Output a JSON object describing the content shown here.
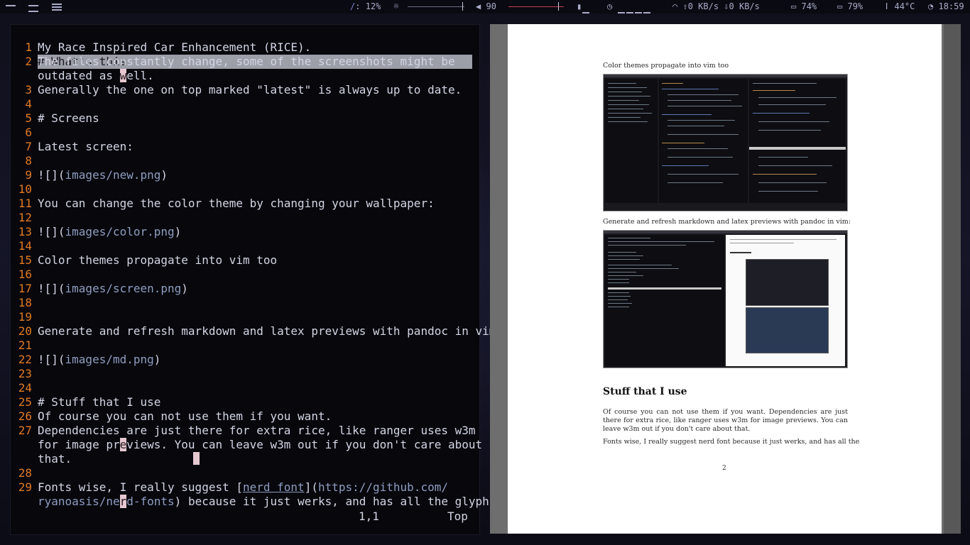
{
  "topbar": {
    "brightness_label": "12%",
    "volume_label": "90",
    "network_up": "0 KB/s",
    "network_down": "0 KB/s",
    "battery1": "74%",
    "battery2": "79%",
    "temperature": "44°C",
    "clock": "18:59",
    "brightness_level": 0.12,
    "volume_level": 0.9,
    "colors": {
      "accent": "#c04050",
      "text": "#a9acc8"
    }
  },
  "editor": {
    "lines": [
      {
        "num": "1",
        "text": "# What's this"
      },
      {
        "num": "1",
        "text": "My Race Inspired Car Enhancement (RICE)."
      },
      {
        "num": "2",
        "text": "The files constantly change, some of the screenshots might be"
      },
      {
        "num": "",
        "text_a": "outdated as ",
        "cursor_char": "w",
        "text_b": "ell."
      },
      {
        "num": "3",
        "text": "Generally the one on top marked \"latest\" is always up to date."
      },
      {
        "num": "4",
        "text": ""
      },
      {
        "num": "5",
        "text": "# Screens"
      },
      {
        "num": "6",
        "text": ""
      },
      {
        "num": "7",
        "text": "Latest screen:"
      },
      {
        "num": "8",
        "text": ""
      },
      {
        "num": "9",
        "prefix": "![](",
        "link": "images/new.png",
        "suffix": ")"
      },
      {
        "num": "10",
        "text": ""
      },
      {
        "num": "11",
        "text": "You can change the color theme by changing your wallpaper:"
      },
      {
        "num": "12",
        "text": ""
      },
      {
        "num": "13",
        "prefix": "![](",
        "link": "images/color.png",
        "suffix": ")"
      },
      {
        "num": "14",
        "text": ""
      },
      {
        "num": "15",
        "text": "Color themes propagate into vim too"
      },
      {
        "num": "16",
        "text": ""
      },
      {
        "num": "17",
        "prefix": "![](",
        "link": "images/screen.png",
        "suffix": ")"
      },
      {
        "num": "18",
        "text": ""
      },
      {
        "num": "19",
        "text": ""
      },
      {
        "num": "20",
        "text": "Generate and refresh markdown and latex previews with pandoc in vim:"
      },
      {
        "num": "21",
        "text": ""
      },
      {
        "num": "22",
        "prefix": "![](",
        "link": "images/md.png",
        "suffix": ")"
      },
      {
        "num": "23",
        "text": ""
      },
      {
        "num": "24",
        "text": ""
      },
      {
        "num": "25",
        "text": "# Stuff that I use"
      },
      {
        "num": "26",
        "text": "Of course you can not use them if you want."
      },
      {
        "num": "27",
        "text": "Dependencies are just there for extra rice, like ranger uses w3m"
      },
      {
        "num": "",
        "text_a": "for image pr",
        "cursor_char": "e",
        "text_b": "views. You can leave w3m out if you don't care about"
      },
      {
        "num": "",
        "text": "that."
      },
      {
        "num": "28",
        "text": ""
      },
      {
        "num": "29",
        "text_a": "Fonts wise, I really suggest [",
        "ul": "nerd font",
        "text_b": "](",
        "link": "https://github.com/"
      },
      {
        "num": "",
        "link_a": "ryanoasis/ne",
        "cursor_char": "r",
        "link_b": "d-fonts",
        "text_b": ") because it just werks, and has all the glyphs."
      }
    ],
    "status_position": "1,1",
    "status_scroll": "Top"
  },
  "preview": {
    "caption1": "Color themes propagate into vim too",
    "caption2": "Generate and refresh markdown and latex previews with pandoc in vim:",
    "heading": "Stuff that I use",
    "para1": "Of course you can not use them if you want. Dependencies are just there for extra rice, like ranger uses w3m for image previews. You can leave w3m out if you don't care about that.",
    "para2": "Fonts wise, I really suggest nerd font because it just werks, and has all the",
    "page_number": "2"
  }
}
